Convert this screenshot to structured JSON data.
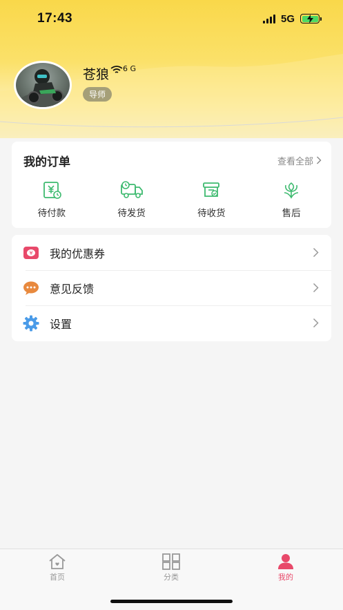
{
  "status_bar": {
    "time": "17:43",
    "network": "5G"
  },
  "profile": {
    "username": "苍狼",
    "username_suffix": "6 G",
    "role": "导师"
  },
  "orders": {
    "title": "我的订单",
    "view_all": "查看全部",
    "items": [
      {
        "label": "待付款",
        "icon": "payment-pending-icon"
      },
      {
        "label": "待发货",
        "icon": "shipping-truck-icon"
      },
      {
        "label": "待收货",
        "icon": "receive-box-icon"
      },
      {
        "label": "售后",
        "icon": "after-sales-flower-icon"
      }
    ]
  },
  "menu": [
    {
      "label": "我的优惠券",
      "icon": "coupon-icon",
      "icon_color": "#e8496a"
    },
    {
      "label": "意见反馈",
      "icon": "chat-bubble-icon",
      "icon_color": "#e8893e"
    },
    {
      "label": "设置",
      "icon": "gear-icon",
      "icon_color": "#4a9be8"
    }
  ],
  "tabbar": {
    "tabs": [
      {
        "label": "首页",
        "icon": "home-icon",
        "active": false
      },
      {
        "label": "分类",
        "icon": "grid-icon",
        "active": false
      },
      {
        "label": "我的",
        "icon": "person-icon",
        "active": true
      }
    ]
  },
  "colors": {
    "accent": "#e8496a",
    "order_icon_green": "#3dba6f",
    "header_yellow": "#f9d84a",
    "role_badge": "#a59f78"
  }
}
